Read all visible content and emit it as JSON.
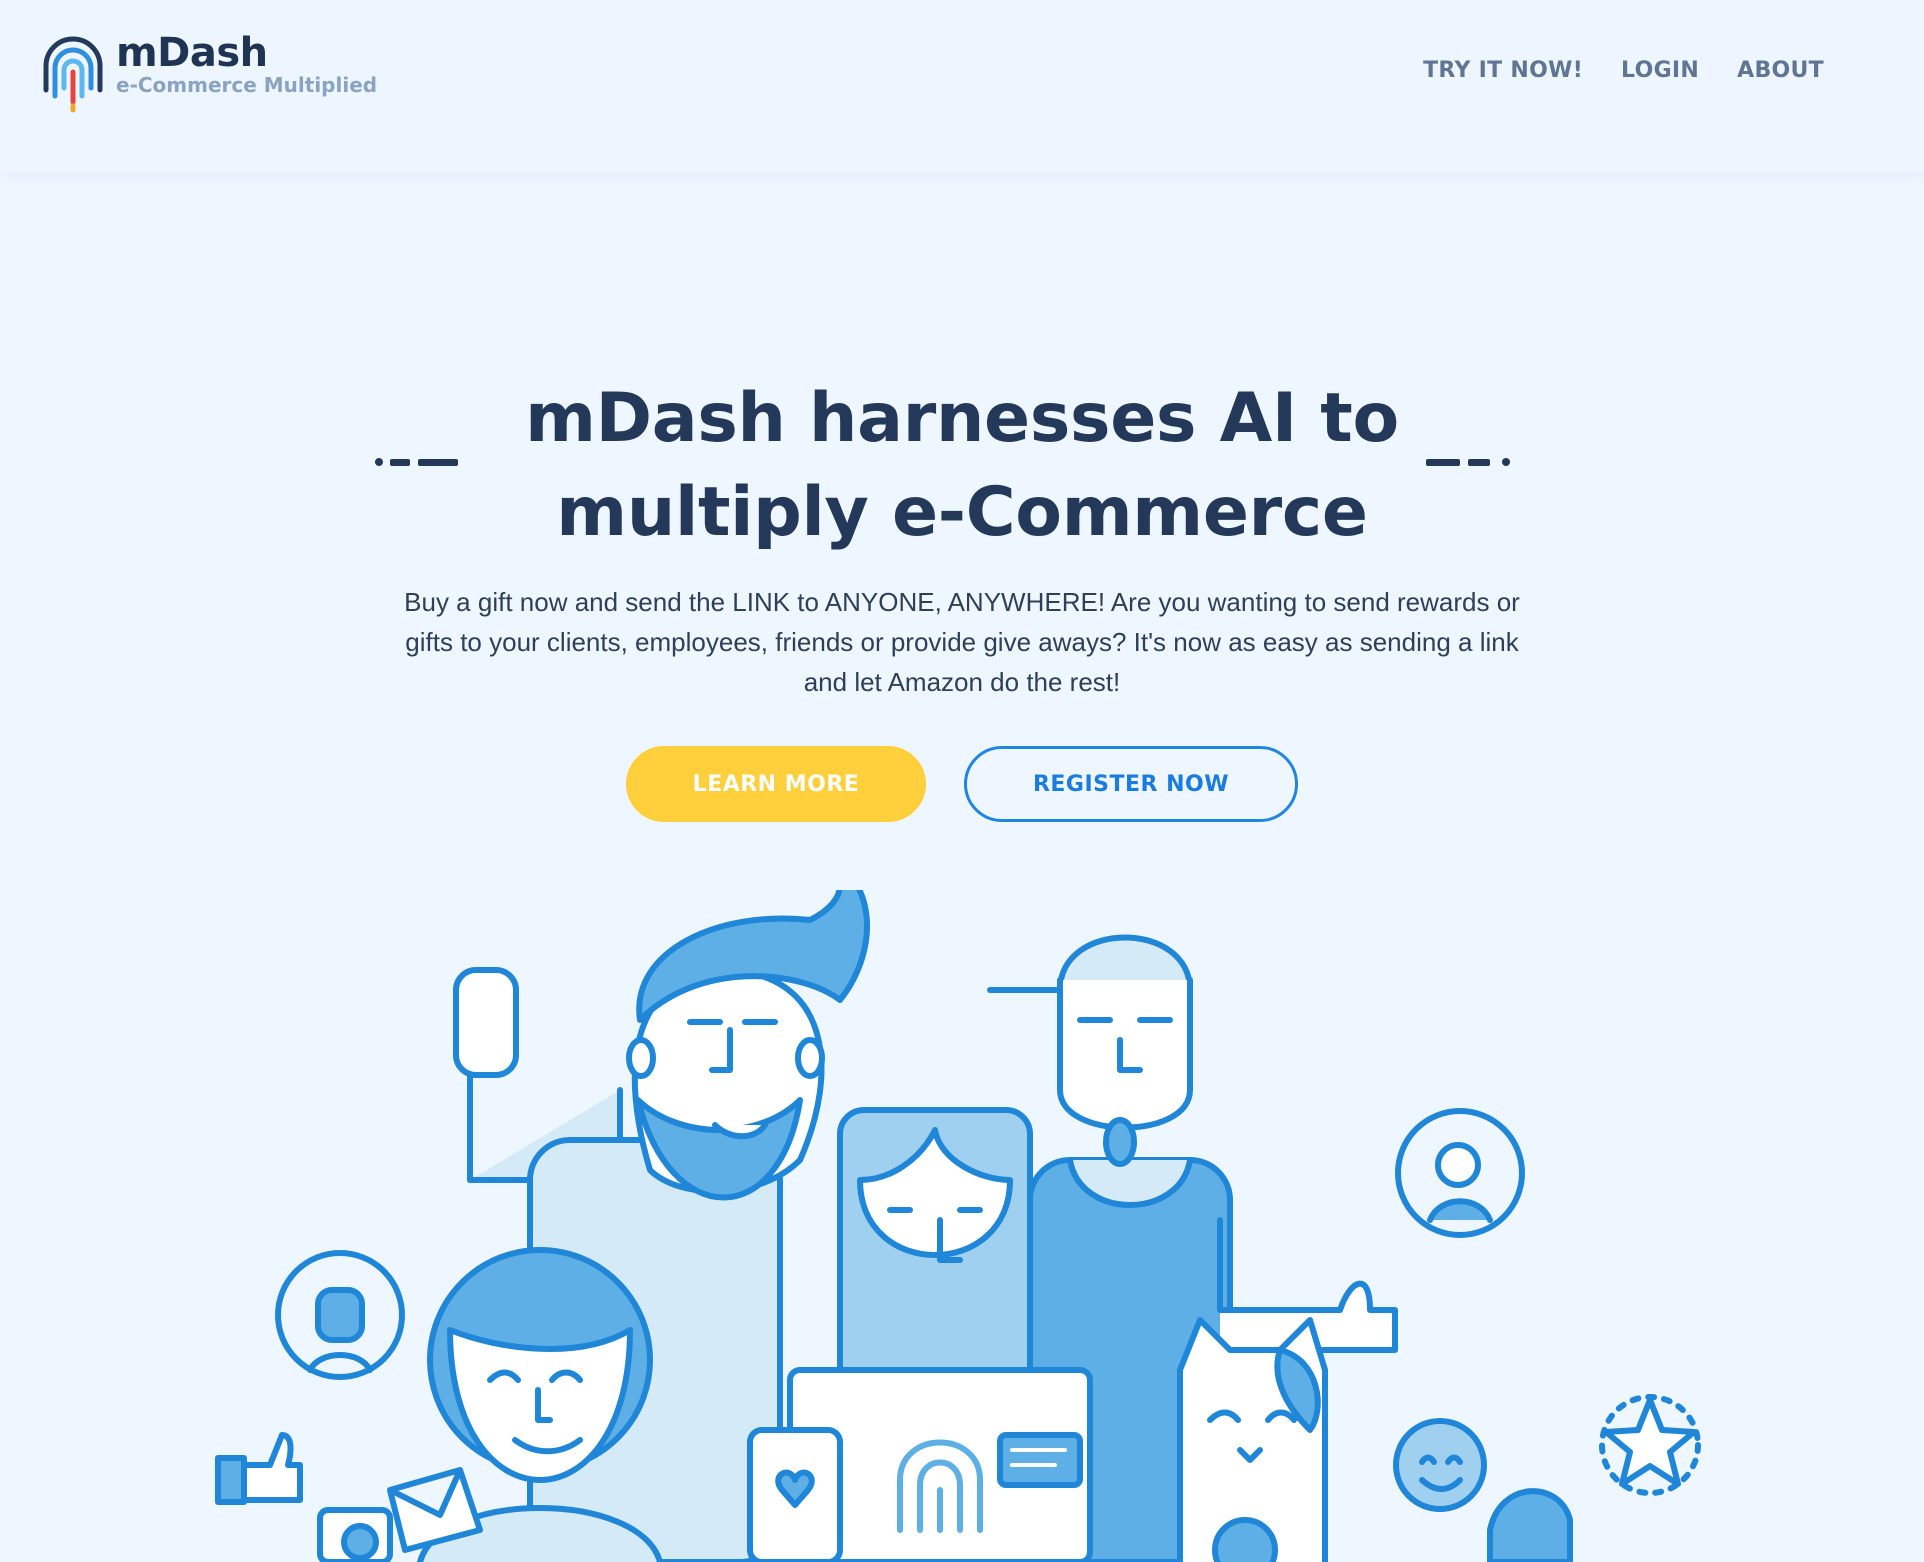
{
  "brand": {
    "name": "mDash",
    "tagline": "e-Commerce Multiplied"
  },
  "nav": {
    "items": [
      "TRY IT NOW!",
      "LOGIN",
      "ABOUT"
    ]
  },
  "hero": {
    "headline": "mDash harnesses AI to multiply e-Commerce",
    "subtext": "Buy a gift now and send the LINK to ANYONE, ANYWHERE! Are you wanting to send rewards or gifts to your clients, employees, friends or provide give aways? It's now as easy as sending a link and let Amazon do the rest!",
    "learn_more_label": "LEARN MORE",
    "register_label": "REGISTER NOW"
  },
  "colors": {
    "background": "#eef6ff",
    "primary_text": "#24395a",
    "accent_yellow": "#ffd03c",
    "accent_blue": "#2186e2",
    "illustration_blue": "#5eafe6"
  }
}
